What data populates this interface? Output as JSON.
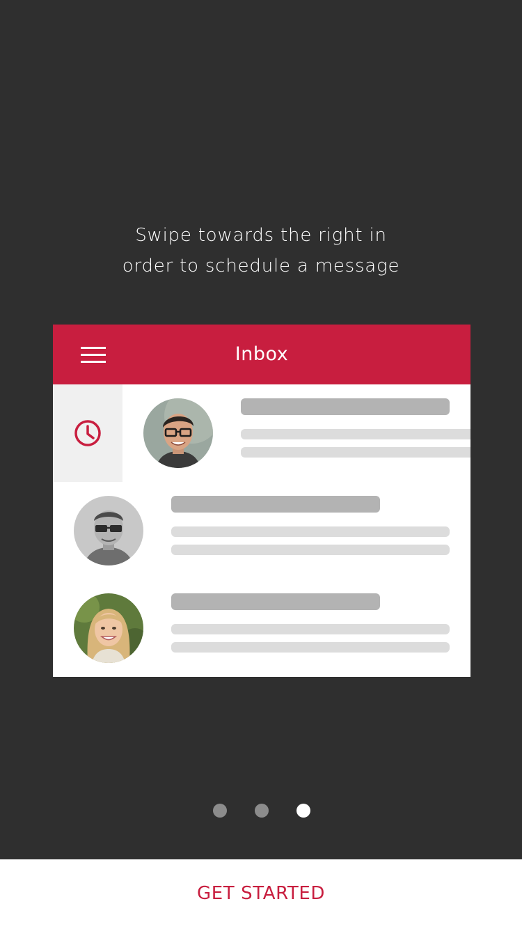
{
  "onboarding": {
    "line1": "Swipe towards the right in",
    "line2": "order to schedule a message"
  },
  "mock_inbox": {
    "title": "Inbox",
    "menu_icon": "hamburger-menu-icon",
    "swipe_action_icon": "clock-icon"
  },
  "pager": {
    "count": 3,
    "active_index": 2
  },
  "cta": {
    "label": "GET STARTED"
  },
  "colors": {
    "background": "#2f2f2f",
    "accent": "#c81e3f",
    "placeholder_dark": "#b3b3b3",
    "placeholder_light": "#dcdcdc",
    "swipe_bg": "#f0f0f0",
    "dot_inactive": "#8c8c8c",
    "dot_active": "#ffffff"
  }
}
